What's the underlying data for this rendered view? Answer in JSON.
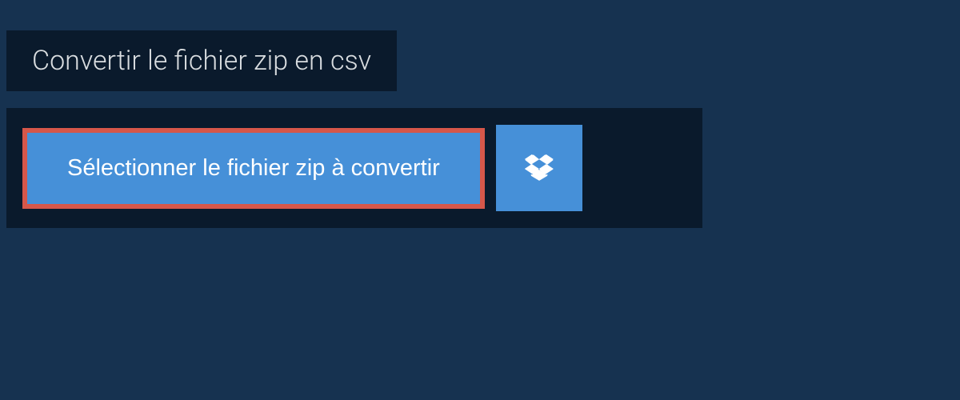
{
  "title": "Convertir le fichier zip en csv",
  "select_button_label": "Sélectionner le fichier zip à convertir",
  "colors": {
    "background": "#163250",
    "panel": "#0a1a2c",
    "button": "#4690d8",
    "highlight_border": "#d6574a"
  }
}
